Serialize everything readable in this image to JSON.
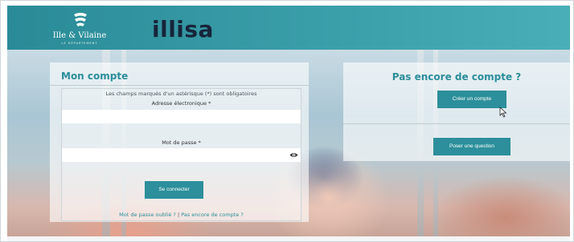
{
  "header": {
    "dept_name": "Ille & Vilaine",
    "dept_sub": "LE DÉPARTEMENT",
    "brand": "illisa"
  },
  "login": {
    "title": "Mon compte",
    "required_note": "Les champs marqués d'un astérisque (*) sont obligatoires",
    "email_label": "Adresse électronique *",
    "email_value": "",
    "password_label": "Mot de passe *",
    "password_value": "",
    "submit_label": "Se connecter",
    "forgot_link": "Mot de passe oublié ?",
    "separator": "|",
    "no_account_link": "Pas encore de compte ?"
  },
  "signup": {
    "title": "Pas encore de compte ?",
    "create_label": "Créer un compte",
    "question_label": "Poser une question"
  },
  "colors": {
    "accent": "#2c8f9b",
    "header": "#3a9ea9",
    "brand_text": "#17243a"
  },
  "icons": {
    "dept_logo": "department-emblem-icon",
    "show_password": "eye-icon",
    "pointer": "mouse-cursor-icon"
  }
}
